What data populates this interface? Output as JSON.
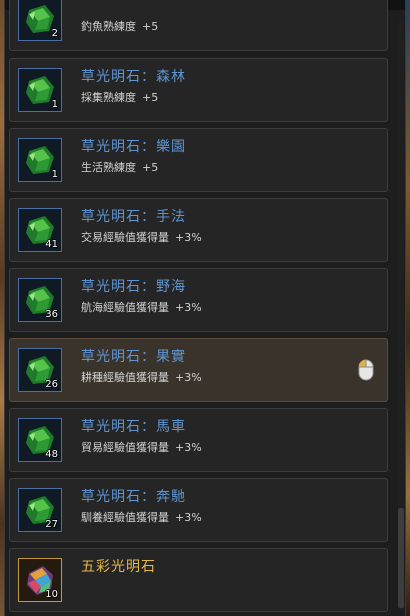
{
  "items": [
    {
      "name": "",
      "desc_label": "釣魚熟練度",
      "desc_value": "+5",
      "quantity": "2",
      "icon": "green-light-stone-icon"
    },
    {
      "name": "草光明石：森林",
      "desc_label": "採集熟練度",
      "desc_value": "+5",
      "quantity": "1",
      "icon": "green-light-stone-icon"
    },
    {
      "name": "草光明石：樂園",
      "desc_label": "生活熟練度",
      "desc_value": "+5",
      "quantity": "1",
      "icon": "green-light-stone-icon"
    },
    {
      "name": "草光明石：手法",
      "desc_label": "交易經驗值獲得量",
      "desc_value": "+3%",
      "quantity": "41",
      "icon": "green-light-stone-icon"
    },
    {
      "name": "草光明石：野海",
      "desc_label": "航海經驗值獲得量",
      "desc_value": "+3%",
      "quantity": "36",
      "icon": "green-light-stone-icon"
    },
    {
      "name": "草光明石：果實",
      "desc_label": "耕種經驗值獲得量",
      "desc_value": "+3%",
      "quantity": "26",
      "icon": "green-light-stone-icon",
      "selected": true
    },
    {
      "name": "草光明石：馬車",
      "desc_label": "貿易經驗值獲得量",
      "desc_value": "+3%",
      "quantity": "48",
      "icon": "green-light-stone-icon"
    },
    {
      "name": "草光明石：奔馳",
      "desc_label": "馴養經驗值獲得量",
      "desc_value": "+3%",
      "quantity": "27",
      "icon": "green-light-stone-icon"
    },
    {
      "name": "五彩光明石",
      "desc_label": "",
      "desc_value": "",
      "quantity": "10",
      "icon": "rainbow-light-stone-icon"
    }
  ],
  "colors": {
    "name_blue": "#5e95d2",
    "name_gold": "#e8b84a",
    "selected_bg": "#3a332c"
  },
  "hint_icon": "mouse-left-click-icon"
}
